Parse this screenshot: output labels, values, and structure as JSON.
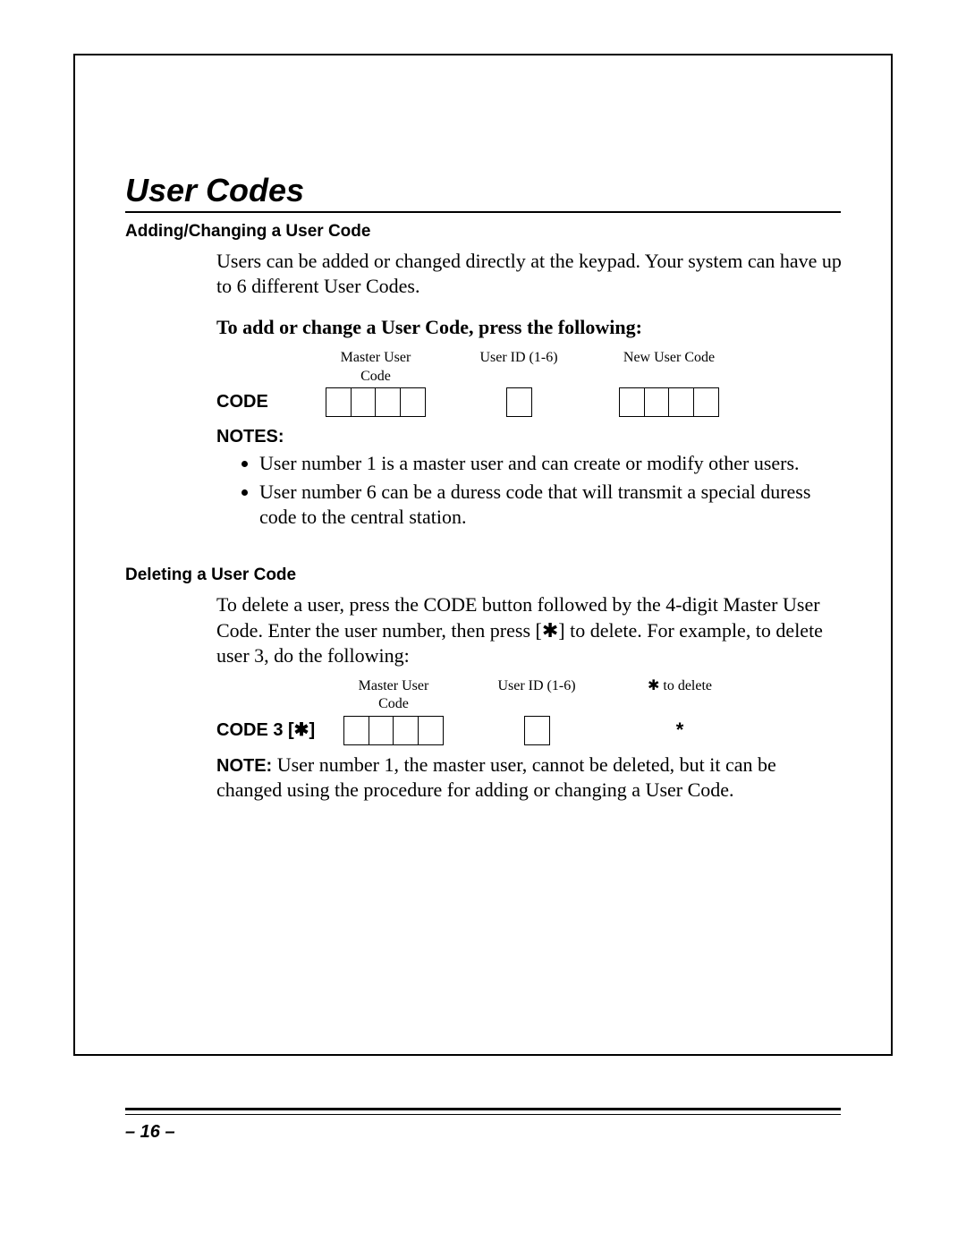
{
  "title": "User Codes",
  "section1": {
    "heading": "Adding/Changing a User Code",
    "para": "Users can be added or changed directly at the keypad. Your system can have up to 6 different User Codes.",
    "instruction": "To add or change a User Code, press the following:",
    "labels": {
      "master": "Master User Code",
      "userid": "User ID (1-6)",
      "newcode": "New User Code"
    },
    "lead": "CODE",
    "notes_label": "NOTES:",
    "notes": [
      "User number 1 is a master user and can create or modify other users.",
      "User number 6 can be a duress code that will transmit a special duress code to the central station."
    ]
  },
  "section2": {
    "heading": "Deleting a User Code",
    "para": "To delete a user, press the CODE button followed by the 4-digit Master User Code. Enter the user number, then press [✱] to delete. For example, to delete user 3, do the following:",
    "labels": {
      "master": "Master User Code",
      "userid": "User ID (1-6)",
      "todelete": "✱ to delete"
    },
    "lead": "CODE 3 [✱]",
    "star": "*",
    "note_bold": "NOTE:",
    "note_text": "  User number 1, the master user, cannot be deleted, but it can be changed using the procedure for adding or changing a User Code."
  },
  "page_number": "– 16 –"
}
